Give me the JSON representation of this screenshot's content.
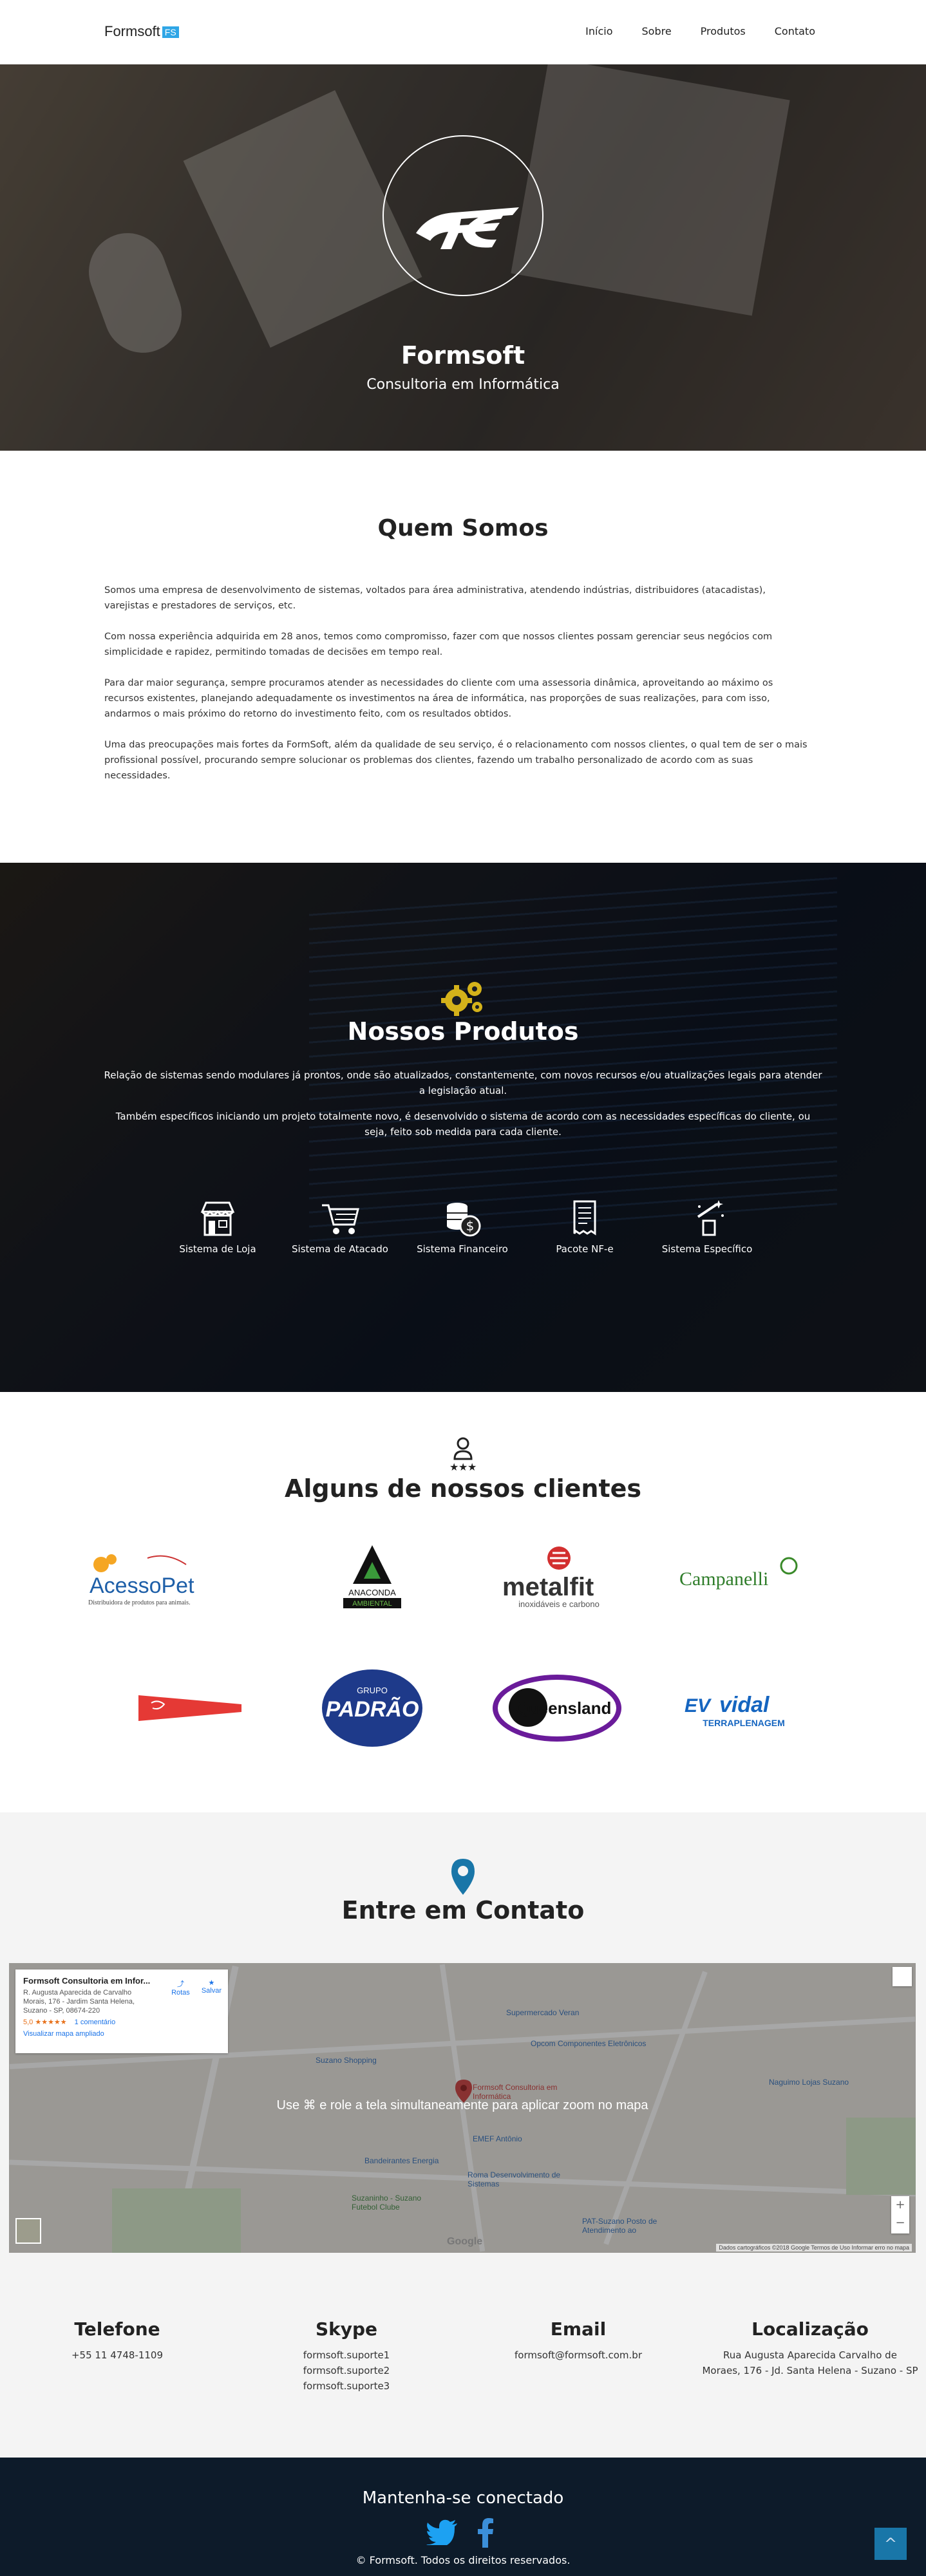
{
  "navbar": {
    "brand": "Formsoft",
    "brand_badge": "FS",
    "links": [
      "Início",
      "Sobre",
      "Produtos",
      "Contato"
    ]
  },
  "hero": {
    "title": "Formsoft",
    "subtitle": "Consultoria em Informática"
  },
  "about": {
    "title": "Quem Somos",
    "paragraphs": [
      "Somos uma empresa de desenvolvimento de sistemas, voltados para área administrativa, atendendo indústrias, distribuidores (atacadistas), varejistas e prestadores de serviços, etc.",
      "Com nossa experiência adquirida em 28 anos, temos como compromisso, fazer com que nossos clientes possam gerenciar seus negócios com simplicidade e rapidez, permitindo tomadas de decisões em tempo real.",
      "Para dar maior segurança, sempre procuramos atender as necessidades do cliente com uma assessoria dinâmica, aproveitando ao máximo os recursos existentes, planejando adequadamente os investimentos na área de informática, nas proporções de suas realizações, para com isso, andarmos o mais próximo do retorno do investimento feito, com os resultados obtidos.",
      "Uma das preocupações mais fortes da FormSoft, além da qualidade de seu serviço, é o relacionamento com nossos clientes, o qual tem de ser o mais profissional possível, procurando sempre solucionar os problemas dos clientes, fazendo um trabalho personalizado de acordo com as suas necessidades."
    ]
  },
  "produtos": {
    "title": "Nossos Produtos",
    "paragraphs": [
      "Relação de sistemas sendo modulares já prontos, onde são atualizados, constantemente, com novos recursos e/ou atualizações legais para atender a legislação atual.",
      "Também específicos iniciando um projeto totalmente novo, é desenvolvido o sistema de acordo com as necessidades específicas do cliente, ou seja, feito sob medida para cada cliente."
    ],
    "items": [
      "Sistema de Loja",
      "Sistema de Atacado",
      "Sistema Financeiro",
      "Pacote NF-e",
      "Sistema Específico"
    ]
  },
  "clients": {
    "title": "Alguns de nossos clientes",
    "logos": [
      {
        "main": "AcessoPet",
        "sub": "Distribuidora de produtos para animais."
      },
      {
        "main": "ANACONDA",
        "sub": "AMBIENTAL"
      },
      {
        "main": "metalfit",
        "sub": "inoxidáveis e carbono"
      },
      {
        "main": "Campanelli",
        "sub": ""
      },
      {
        "main": "",
        "sub": ""
      },
      {
        "main": "PADRÃO",
        "sub": "GRUPO"
      },
      {
        "main": "Queensland",
        "sub": ""
      },
      {
        "main": "vidal",
        "sub": "TERRAPLENAGEM"
      }
    ]
  },
  "contato": {
    "title": "Entre em Contato",
    "map": {
      "message": "Use ⌘ e role a tela simultaneamente para aplicar zoom no mapa",
      "card_title": "Formsoft Consultoria em Infor...",
      "card_address": "R. Augusta Aparecida de Carvalho Morais, 176 - Jardim Santa Helena, Suzano - SP, 08674-220",
      "card_rating": "5,0 ★★★★★",
      "card_reviews": "1 comentário",
      "card_link": "Visualizar mapa ampliado",
      "action_routes": "Rotas",
      "action_save": "Salvar",
      "labels": [
        "Supermercado Veran",
        "Opcom Componentes Eletrônicos",
        "Suzano Shopping",
        "Formsoft Consultoria em Informática",
        "EMEF Antônio",
        "Roma Desenvolvimento de Sistemas",
        "Suzaninho - Suzano Futebol Clube",
        "PAT-Suzano Posto de Atendimento ao",
        "Naguimo Lojas Suzano",
        "Bandeirantes Energia"
      ],
      "footer": "Dados cartográficos ©2018 Google   Termos de Uso   Informar erro no mapa",
      "zoom_in": "+",
      "zoom_out": "−"
    },
    "info": [
      {
        "title": "Telefone",
        "lines": [
          "+55 11 4748-1109"
        ]
      },
      {
        "title": "Skype",
        "lines": [
          "formsoft.suporte1",
          "formsoft.suporte2",
          "formsoft.suporte3"
        ]
      },
      {
        "title": "Email",
        "lines": [
          "formsoft@formsoft.com.br"
        ]
      },
      {
        "title": "Localização",
        "lines": [
          "Rua Augusta Aparecida Carvalho de",
          "Moraes, 176 - Jd. Santa Helena - Suzano - SP"
        ]
      }
    ]
  },
  "footer": {
    "title": "Mantenha-se conectado",
    "copyright": "© Formsoft. Todos os direitos reservados.",
    "back_to_top": "^"
  },
  "colors": {
    "accent": "#2fa6e6",
    "footer_bg": "#0d1b2a",
    "gold": "#d4b21a"
  }
}
